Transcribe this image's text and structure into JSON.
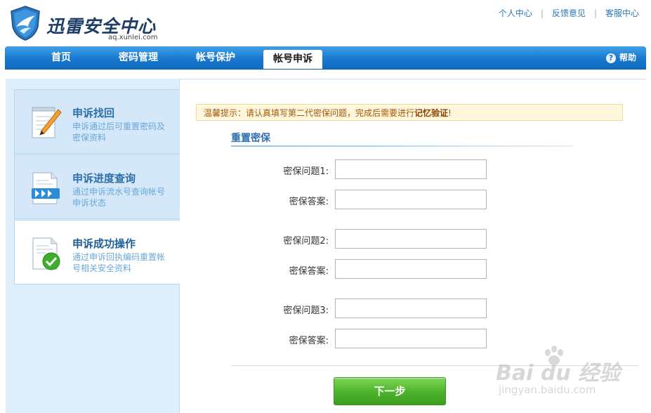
{
  "header": {
    "logo_title": "迅雷安全中心",
    "logo_subtitle": "aq.xunlei.com",
    "links": [
      "个人中心",
      "反馈意见",
      "客服中心"
    ],
    "separator": "|"
  },
  "nav": {
    "items": [
      "首页",
      "密码管理",
      "帐号保护",
      "帐号申诉"
    ],
    "active": "帐号申诉",
    "help_label": "帮助"
  },
  "sidebar": {
    "items": [
      {
        "title": "申诉找回",
        "desc": "申诉通过后可重置密码及密保资料",
        "icon": "notepad-pencil-icon",
        "active": false
      },
      {
        "title": "申诉进度查询",
        "desc": "通过申诉流水号查询帐号申诉状态",
        "icon": "document-arrows-icon",
        "active": false
      },
      {
        "title": "申诉成功操作",
        "desc": "通过申诉回执编码重置帐号相关安全资料",
        "icon": "document-check-icon",
        "active": true
      }
    ]
  },
  "main": {
    "tip_prefix": "温馨提示：请认真填写第二代密保问题，完成后需要进行",
    "tip_bold": "记忆验证",
    "tip_suffix": "!",
    "section_title": "重置密保",
    "fields": [
      {
        "label": "密保问题1:",
        "value": ""
      },
      {
        "label": "密保答案:",
        "value": ""
      },
      {
        "label": "密保问题2:",
        "value": ""
      },
      {
        "label": "密保答案:",
        "value": ""
      },
      {
        "label": "密保问题3:",
        "value": ""
      },
      {
        "label": "密保答案:",
        "value": ""
      }
    ],
    "next_button": "下一步"
  },
  "watermark": {
    "text": "Bai du 经验",
    "sub": "jingyan.baidu.com"
  },
  "colors": {
    "nav_blue": "#1978cf",
    "sidebar_bg": "#dfeefb",
    "title_blue": "#2c6fae",
    "button_green": "#4bb22a",
    "tip_bg": "#fff7dc"
  }
}
